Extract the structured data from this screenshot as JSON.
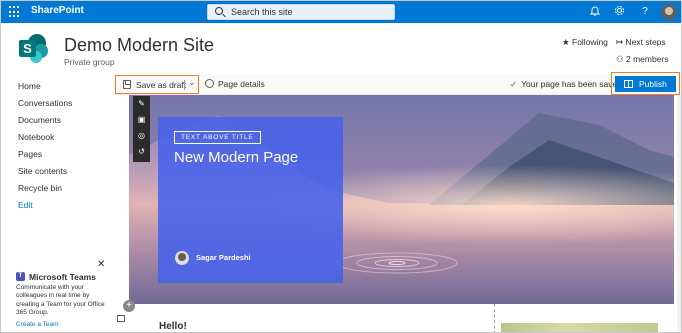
{
  "suite": {
    "app_name": "SharePoint",
    "search_placeholder": "Search this site",
    "bell_icon": "bell-icon",
    "gear_icon": "gear-icon",
    "help_icon": "help-icon",
    "help_glyph": "?"
  },
  "site": {
    "title": "Demo Modern Site",
    "subtitle": "Private group",
    "logo_letter": "S",
    "following_label": "Following",
    "next_steps_label": "Next steps",
    "members_label": "2 members"
  },
  "nav": {
    "items": [
      {
        "label": "Home"
      },
      {
        "label": "Conversations"
      },
      {
        "label": "Documents"
      },
      {
        "label": "Notebook"
      },
      {
        "label": "Pages"
      },
      {
        "label": "Site contents"
      },
      {
        "label": "Recycle bin"
      }
    ],
    "edit_label": "Edit"
  },
  "teams": {
    "title": "Microsoft Teams",
    "description": "Communicate with your colleagues in real time by creating a Team for your Office 365 Group.",
    "link": "Create a Team",
    "logo_letter": "T"
  },
  "command_bar": {
    "save_label": "Save as draft",
    "page_details_label": "Page details",
    "saved_message": "Your page has been saved",
    "publish_label": "Publish"
  },
  "hero": {
    "text_above_title": "TEXT ABOVE TITLE",
    "page_title": "New Modern Page",
    "author": "Sagar  Pardeshi"
  },
  "content": {
    "hello": "Hello!"
  },
  "colors": {
    "suite_bar": "#0078d4",
    "highlight": "#ed7d31",
    "title_box": "#4662eb"
  }
}
